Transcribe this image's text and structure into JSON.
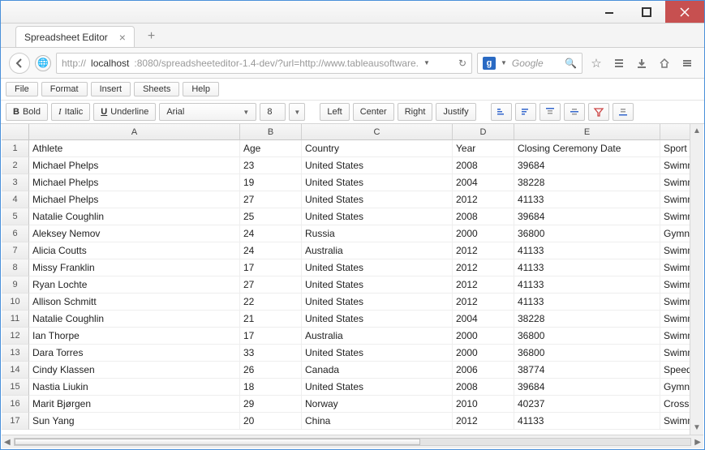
{
  "window": {
    "tab_title": "Spreadsheet Editor"
  },
  "address": {
    "prefix": "http://",
    "host": "localhost",
    "rest": ":8080/spreadsheeteditor-1.4-dev/?url=http://www.tableausoftware.",
    "search_placeholder": "Google"
  },
  "menu": {
    "file": "File",
    "format": "Format",
    "insert": "Insert",
    "sheets": "Sheets",
    "help": "Help"
  },
  "toolbar": {
    "bold": "Bold",
    "italic": "Italic",
    "underline": "Underline",
    "font": "Arial",
    "size": "8",
    "left": "Left",
    "center": "Center",
    "right": "Right",
    "justify": "Justify"
  },
  "columns": [
    "A",
    "B",
    "C",
    "D",
    "E"
  ],
  "headers": [
    "Athlete",
    "Age",
    "Country",
    "Year",
    "Closing Ceremony Date",
    "Sport"
  ],
  "rows": [
    [
      "Michael Phelps",
      "23",
      "United States",
      "2008",
      "39684",
      "Swimming"
    ],
    [
      "Michael Phelps",
      "19",
      "United States",
      "2004",
      "38228",
      "Swimming"
    ],
    [
      "Michael Phelps",
      "27",
      "United States",
      "2012",
      "41133",
      "Swimming"
    ],
    [
      "Natalie Coughlin",
      "25",
      "United States",
      "2008",
      "39684",
      "Swimming"
    ],
    [
      "Aleksey Nemov",
      "24",
      "Russia",
      "2000",
      "36800",
      "Gymnastic"
    ],
    [
      "Alicia Coutts",
      "24",
      "Australia",
      "2012",
      "41133",
      "Swimming"
    ],
    [
      "Missy Franklin",
      "17",
      "United States",
      "2012",
      "41133",
      "Swimming"
    ],
    [
      "Ryan Lochte",
      "27",
      "United States",
      "2012",
      "41133",
      "Swimming"
    ],
    [
      "Allison Schmitt",
      "22",
      "United States",
      "2012",
      "41133",
      "Swimming"
    ],
    [
      "Natalie Coughlin",
      "21",
      "United States",
      "2004",
      "38228",
      "Swimming"
    ],
    [
      "Ian Thorpe",
      "17",
      "Australia",
      "2000",
      "36800",
      "Swimming"
    ],
    [
      "Dara Torres",
      "33",
      "United States",
      "2000",
      "36800",
      "Swimming"
    ],
    [
      "Cindy Klassen",
      "26",
      "Canada",
      "2006",
      "38774",
      "Speed Ska"
    ],
    [
      "Nastia Liukin",
      "18",
      "United States",
      "2008",
      "39684",
      "Gymnastic"
    ],
    [
      "Marit Bjørgen",
      "29",
      "Norway",
      "2010",
      "40237",
      "Cross Cou"
    ],
    [
      "Sun Yang",
      "20",
      "China",
      "2012",
      "41133",
      "Swimming"
    ]
  ]
}
